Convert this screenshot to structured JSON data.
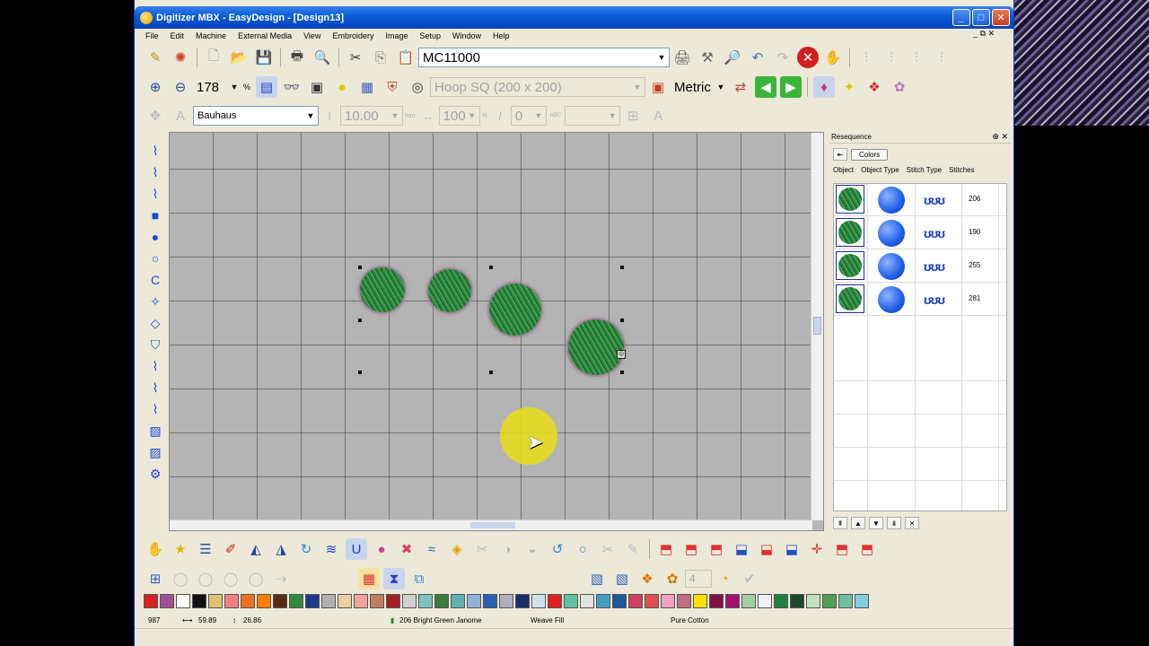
{
  "window": {
    "title": "Digitizer MBX - EasyDesign - [Design13]",
    "controls": {
      "min": "_",
      "max": "□",
      "close": "✕"
    }
  },
  "menu": {
    "items": [
      "File",
      "Edit",
      "Machine",
      "External Media",
      "View",
      "Embroidery",
      "Image",
      "Setup",
      "Window",
      "Help"
    ],
    "doc_controls": "_ ⧉ ✕"
  },
  "toolbar1": {
    "machine": "MC11000"
  },
  "toolbar2": {
    "zoom": "178",
    "zoom_unit": "%",
    "hoop": "Hoop SQ (200 x 200)",
    "units": "Metric"
  },
  "toolbar3": {
    "font": "Bauhaus",
    "height": "10.00",
    "height_unit": "mm",
    "width": "100",
    "width_unit": "%",
    "italic": "0",
    "abc_label": "ABC"
  },
  "panel": {
    "title": "Resequence",
    "colors_button": "Colors",
    "headers": [
      "Object",
      "Object Type",
      "Stitch Type",
      "Stitches"
    ],
    "rows": [
      {
        "stitch_symbol": "ʊʊʊ",
        "stitches": "206"
      },
      {
        "stitch_symbol": "ʊʊʊ",
        "stitches": "190"
      },
      {
        "stitch_symbol": "ʊʊʊ",
        "stitches": "255"
      },
      {
        "stitch_symbol": "ʊʊʊ",
        "stitches": "281"
      }
    ]
  },
  "palette": [
    "#d82020",
    "#a0509a",
    "#ffffff",
    "#111111",
    "#e0c070",
    "#f08080",
    "#f07020",
    "#ff8000",
    "#5a2a10",
    "#2e8a3e",
    "#1a3a8a",
    "#b0b0b0",
    "#e8d0a0",
    "#f4a0a0",
    "#c08060",
    "#a02020",
    "#d0d0d0",
    "#80c0c0",
    "#3a7a3a",
    "#60b0b0",
    "#90b0d8",
    "#2a60b0",
    "#b0b0c0",
    "#1a2f6a",
    "#d0e0f0",
    "#e02020",
    "#60c0a0",
    "#e0e0e0",
    "#40a0c0",
    "#1a5a9a",
    "#d04060",
    "#e05050",
    "#f0a0c0",
    "#c07080",
    "#ffe000",
    "#801040",
    "#a01070",
    "#a0d0a0",
    "#f0f0f0",
    "#208040",
    "#1a4a2a",
    "#c0e0c0",
    "#50a050",
    "#70c0a0",
    "#80d0e0"
  ],
  "status": {
    "stitch_count": "987",
    "width": "59.89",
    "height": "26.86",
    "thread": "206 Bright Green Janome",
    "fill": "Weave Fill",
    "material": "Pure Cotton"
  },
  "colors": {
    "title_blue": "#0a5fd6",
    "selection": "#1a2f9a",
    "fabric": "#b4b4b4"
  }
}
